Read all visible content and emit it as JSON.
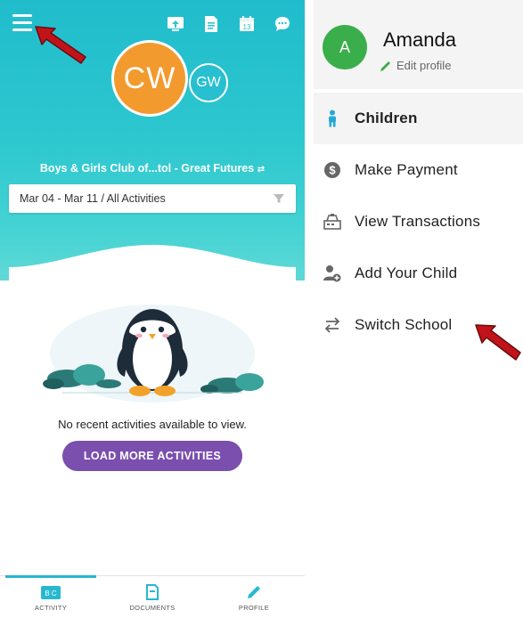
{
  "left_screen": {
    "avatar_main": "CW",
    "avatar_secondary": "GW",
    "org_name": "Boys & Girls Club of...tol - Great Futures",
    "filter": "Mar 04 - Mar 11 / All Activities",
    "empty_message": "No recent activities available to view.",
    "load_more": "LOAD MORE ACTIVITIES",
    "nav": {
      "activity": "ACTIVITY",
      "documents": "DOCUMENTS",
      "profile": "PROFILE"
    },
    "nav_badge": "B C",
    "calendar_number": "13"
  },
  "drawer": {
    "avatar_initial": "A",
    "user_name": "Amanda",
    "edit_profile": "Edit profile",
    "items": [
      {
        "label": "Children"
      },
      {
        "label": "Make Payment"
      },
      {
        "label": "View Transactions"
      },
      {
        "label": "Add Your Child"
      },
      {
        "label": "Switch School"
      }
    ]
  },
  "colors": {
    "hero_teal": "#21bccc",
    "avatar_orange": "#f29a2e",
    "button_purple": "#7a4fae",
    "drawer_avatar_green": "#3aae4a",
    "annotation_arrow": "#c0141a"
  }
}
